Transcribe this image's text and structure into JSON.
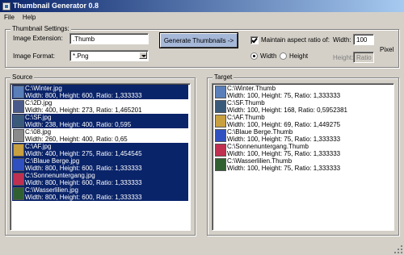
{
  "window": {
    "title": "Thumbnail Generator 0.8"
  },
  "menu": [
    "File",
    "Help"
  ],
  "settings": {
    "legend": "Thumbnail Settings:",
    "image_extension_label": "Image Extension:",
    "image_extension_value": ".Thumb",
    "image_format_label": "Image Format:",
    "image_format_value": "*.Png",
    "generate_button": "Generate Thumbnails ->",
    "maintain_aspect_label": "Maintain aspect ratio of:",
    "maintain_aspect_checked": true,
    "radio_width_label": "Width",
    "radio_height_label": "Height",
    "radio_selected": "width",
    "width_label": "Width:",
    "width_value": "100",
    "height_label": "Height:",
    "height_value": "Ratio",
    "unit_label": "Pixel"
  },
  "source": {
    "legend": "Source",
    "items": [
      {
        "name": "C:\\Winter.jpg",
        "info": "Width: 800, Height: 600, Ratio: 1,333333",
        "selected": true,
        "icon_color": "#5a7fb8"
      },
      {
        "name": "C:\\2D.jpg",
        "info": "Width: 400, Height: 273, Ratio: 1,465201",
        "selected": false,
        "icon_color": "#4a5a8a"
      },
      {
        "name": "C:\\SF.jpg",
        "info": "Width: 238, Height: 400, Ratio: 0,595",
        "selected": true,
        "icon_color": "#3a5a7a"
      },
      {
        "name": "C:\\08.jpg",
        "info": "Width: 260, Height: 400, Ratio: 0,65",
        "selected": false,
        "icon_color": "#8a8a8a"
      },
      {
        "name": "C:\\AF.jpg",
        "info": "Width: 400, Height: 275, Ratio: 1,454545",
        "selected": true,
        "icon_color": "#c8a040"
      },
      {
        "name": "C:\\Blaue Berge.jpg",
        "info": "Width: 800, Height: 600, Ratio: 1,333333",
        "selected": true,
        "icon_color": "#3050c0"
      },
      {
        "name": "C:\\Sonnenuntergang.jpg",
        "info": "Width: 800, Height: 600, Ratio: 1,333333",
        "selected": true,
        "icon_color": "#c03050"
      },
      {
        "name": "C:\\Wasserlilien.jpg",
        "info": "Width: 800, Height: 600, Ratio: 1,333333",
        "selected": true,
        "icon_color": "#306030"
      }
    ]
  },
  "target": {
    "legend": "Target",
    "items": [
      {
        "name": "C:\\Winter.Thumb",
        "info": "Width: 100, Height: 75, Ratio: 1,333333",
        "icon_color": "#5a7fb8"
      },
      {
        "name": "C:\\SF.Thumb",
        "info": "Width: 100, Height: 168, Ratio: 0,5952381",
        "icon_color": "#3a5a7a"
      },
      {
        "name": "C:\\AF.Thumb",
        "info": "Width: 100, Height: 69, Ratio: 1,449275",
        "icon_color": "#c8a040"
      },
      {
        "name": "C:\\Blaue Berge.Thumb",
        "info": "Width: 100, Height: 75, Ratio: 1,333333",
        "icon_color": "#3050c0"
      },
      {
        "name": "C:\\Sonnenuntergang.Thumb",
        "info": "Width: 100, Height: 75, Ratio: 1,333333",
        "icon_color": "#c03050"
      },
      {
        "name": "C:\\Wasserlilien.Thumb",
        "info": "Width: 100, Height: 75, Ratio: 1,333333",
        "icon_color": "#306030"
      }
    ]
  }
}
